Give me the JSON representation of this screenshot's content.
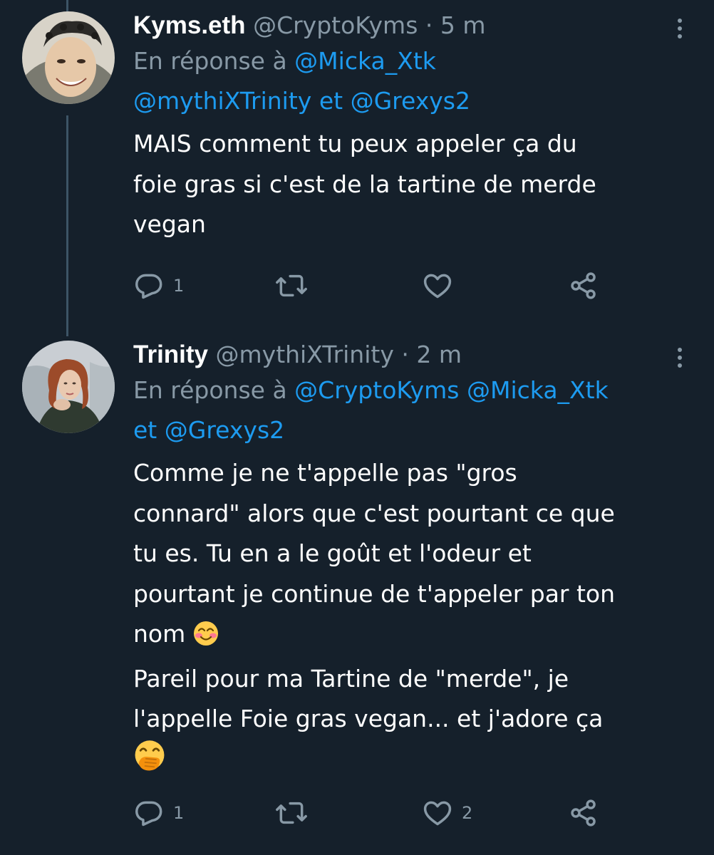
{
  "tweets": [
    {
      "name": "Kyms.eth",
      "handle": "@CryptoKyms",
      "sep": "·",
      "time": "5 m",
      "reply_prefix": "En réponse à",
      "reply_parts": [
        {
          "text": "@Micka_Xtk",
          "mention": true
        },
        {
          "text": "@mythiXTrinity",
          "mention": true
        },
        {
          "text": "et",
          "mention": false
        },
        {
          "text": "@Grexys2",
          "mention": true
        }
      ],
      "body": [
        "MAIS comment tu peux appeler ça du",
        "foie gras si c'est de la tartine de merde",
        "vegan"
      ],
      "actions": {
        "reply_count": "1",
        "retweet_count": "",
        "like_count": ""
      }
    },
    {
      "name": "Trinity",
      "handle": "@mythiXTrinity",
      "sep": "·",
      "time": "2 m",
      "reply_prefix": "En réponse à",
      "reply_parts": [
        {
          "text": "@CryptoKyms",
          "mention": true
        },
        {
          "text": "@Micka_Xtk",
          "mention": true
        },
        {
          "text": "et",
          "mention": false
        },
        {
          "text": "@Grexys2",
          "mention": true
        }
      ],
      "body": [
        "Comme je ne t'appelle pas \"gros",
        "connard\" alors que c'est pourtant ce que",
        "tu es. Tu en a le goût et l'odeur et",
        "pourtant je continue de t'appeler par ton",
        "nom",
        "Pareil pour ma Tartine de \"merde\", je",
        "l'appelle Foie gras vegan... et j'adore ça"
      ],
      "emoji": [
        "smiling-face-with-smiling-eyes",
        "face-with-hand-over-mouth"
      ],
      "actions": {
        "reply_count": "1",
        "retweet_count": "",
        "like_count": "2"
      }
    }
  ],
  "colors": {
    "background": "#15202b",
    "primary_text": "#ffffff",
    "secondary_text": "#8899a6",
    "mention": "#1d9bf0",
    "thread_line": "#3d5466"
  },
  "icons": [
    "reply-icon",
    "retweet-icon",
    "heart-icon",
    "share-icon",
    "more-icon"
  ]
}
